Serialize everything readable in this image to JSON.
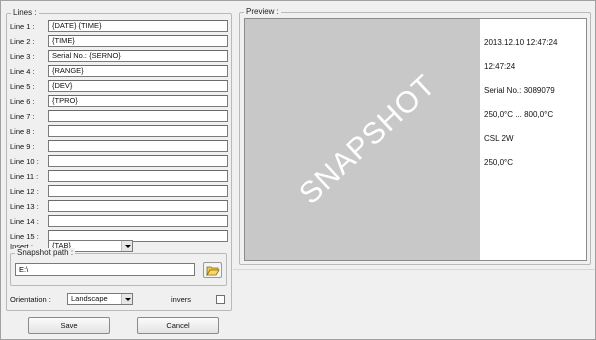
{
  "lines_group": {
    "title": "Lines :",
    "rows": [
      {
        "label": "Line 1 :",
        "value": "{DATE} {TIME}"
      },
      {
        "label": "Line 2 :",
        "value": "{TIME}"
      },
      {
        "label": "Line 3 :",
        "value": "Serial No.: {SERNO}"
      },
      {
        "label": "Line 4 :",
        "value": "{RANGE}"
      },
      {
        "label": "Line 5 :",
        "value": "{DEV}"
      },
      {
        "label": "Line 6 :",
        "value": "{TPRO}"
      },
      {
        "label": "Line 7 :",
        "value": ""
      },
      {
        "label": "Line 8 :",
        "value": ""
      },
      {
        "label": "Line 9 :",
        "value": ""
      },
      {
        "label": "Line 10 :",
        "value": ""
      },
      {
        "label": "Line 11 :",
        "value": ""
      },
      {
        "label": "Line 12 :",
        "value": ""
      },
      {
        "label": "Line 13 :",
        "value": ""
      },
      {
        "label": "Line 14 :",
        "value": ""
      },
      {
        "label": "Line 15 :",
        "value": ""
      }
    ]
  },
  "insert": {
    "label": "Insert :",
    "value": "{TAB}"
  },
  "snapshot": {
    "title": "Snapshot path :",
    "value": "E:\\"
  },
  "orientation": {
    "label": "Orientation :",
    "value": "Landscape",
    "invers_label": "invers"
  },
  "buttons": {
    "save": "Save",
    "cancel": "Cancel"
  },
  "preview": {
    "title": "Preview :",
    "watermark": "SNAPSHOT",
    "lines": [
      "2013.12.10 12:47:24",
      "12:47:24",
      "Serial No.: 3089079",
      "250,0°C ... 800,0°C",
      "CSL 2W",
      "250,0°C"
    ]
  }
}
